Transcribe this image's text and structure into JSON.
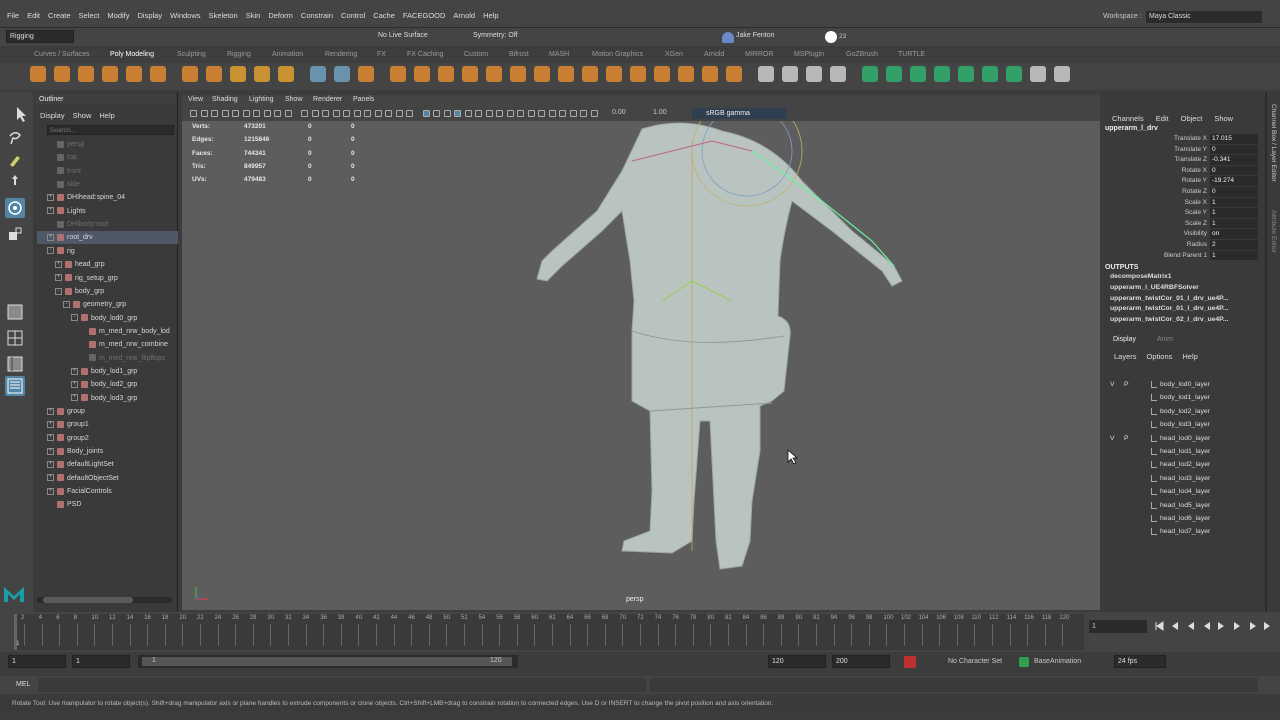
{
  "menubar": {
    "items": [
      "File",
      "Edit",
      "Create",
      "Select",
      "Modify",
      "Display",
      "Windows",
      "Skeleton",
      "Skin",
      "Deform",
      "Constrain",
      "Control",
      "Cache",
      "FACEGOOD",
      "Arnold",
      "Help"
    ],
    "workspace_label": "Workspace :",
    "workspace_value": "Maya Classic"
  },
  "status": {
    "mode": "Rigging",
    "live_surface": "No Live Surface",
    "symmetry": "Symmetry: Off",
    "user": "Jake Fenton",
    "notifications": "23"
  },
  "shelf_tabs": [
    "Curves / Surfaces",
    "Poly Modeling",
    "Sculpting",
    "Rigging",
    "Animation",
    "Rendering",
    "FX",
    "FX Caching",
    "Custom",
    "Bifrost",
    "MASH",
    "Motion Graphics",
    "XGen",
    "Arnold",
    "MIRROR",
    "MSPlugin",
    "GoZBrush",
    "TURTLE"
  ],
  "shelf_active": "Poly Modeling",
  "outliner": {
    "title": "Outliner",
    "menus": [
      "Display",
      "Show",
      "Help"
    ],
    "search_placeholder": "Search...",
    "rows": [
      {
        "label": "persp",
        "indent": 0,
        "dim": true,
        "exp": ""
      },
      {
        "label": "top",
        "indent": 0,
        "dim": true,
        "exp": ""
      },
      {
        "label": "front",
        "indent": 0,
        "dim": true,
        "exp": ""
      },
      {
        "label": "side",
        "indent": 0,
        "dim": true,
        "exp": ""
      },
      {
        "label": "DHIhead:spine_04",
        "indent": 0,
        "dim": false,
        "exp": "+"
      },
      {
        "label": "Lights",
        "indent": 0,
        "dim": false,
        "exp": "+"
      },
      {
        "label": "DHIbody:root",
        "indent": 0,
        "dim": true,
        "exp": ""
      },
      {
        "label": "root_drv",
        "indent": 0,
        "dim": false,
        "exp": "+",
        "sel": true
      },
      {
        "label": "rig",
        "indent": 0,
        "dim": false,
        "exp": "-"
      },
      {
        "label": "head_grp",
        "indent": 1,
        "dim": false,
        "exp": "+"
      },
      {
        "label": "rig_setup_grp",
        "indent": 1,
        "dim": false,
        "exp": "+"
      },
      {
        "label": "body_grp",
        "indent": 1,
        "dim": false,
        "exp": "-"
      },
      {
        "label": "geometry_grp",
        "indent": 2,
        "dim": false,
        "exp": "-"
      },
      {
        "label": "body_lod0_grp",
        "indent": 3,
        "dim": false,
        "exp": "-"
      },
      {
        "label": "m_med_nrw_body_lod",
        "indent": 4,
        "dim": false,
        "exp": ""
      },
      {
        "label": "m_med_nrw_combine",
        "indent": 4,
        "dim": false,
        "exp": ""
      },
      {
        "label": "m_med_nrw_flipflops",
        "indent": 4,
        "dim": true,
        "exp": ""
      },
      {
        "label": "body_lod1_grp",
        "indent": 3,
        "dim": false,
        "exp": "+"
      },
      {
        "label": "body_lod2_grp",
        "indent": 3,
        "dim": false,
        "exp": "+"
      },
      {
        "label": "body_lod3_grp",
        "indent": 3,
        "dim": false,
        "exp": "+"
      },
      {
        "label": "group",
        "indent": 0,
        "dim": false,
        "exp": "+"
      },
      {
        "label": "group1",
        "indent": 0,
        "dim": false,
        "exp": "+"
      },
      {
        "label": "group2",
        "indent": 0,
        "dim": false,
        "exp": "+"
      },
      {
        "label": "Body_joints",
        "indent": 0,
        "dim": false,
        "exp": "+"
      },
      {
        "label": "defaultLightSet",
        "indent": 0,
        "dim": false,
        "exp": "+"
      },
      {
        "label": "defaultObjectSet",
        "indent": 0,
        "dim": false,
        "exp": "+"
      },
      {
        "label": "FacialControls",
        "indent": 0,
        "dim": false,
        "exp": "+"
      },
      {
        "label": "PSD",
        "indent": 0,
        "dim": false,
        "exp": ""
      }
    ]
  },
  "viewport": {
    "menus": [
      "View",
      "Shading",
      "Lighting",
      "Show",
      "Renderer",
      "Panels"
    ],
    "exposure": "0.00",
    "gamma": "1.00",
    "colorspace": "sRGB gamma",
    "camera": "persp",
    "hud": [
      [
        "Verts:",
        "473201",
        "0",
        "0"
      ],
      [
        "Edges:",
        "1215846",
        "0",
        "0"
      ],
      [
        "Faces:",
        "744341",
        "0",
        "0"
      ],
      [
        "Tris:",
        "849957",
        "0",
        "0"
      ],
      [
        "UVs:",
        "479483",
        "0",
        "0"
      ]
    ]
  },
  "channel": {
    "menus": [
      "Channels",
      "Edit",
      "Object",
      "Show"
    ],
    "object": "upperarm_l_drv",
    "attrs": [
      [
        "Translate X",
        "17.015"
      ],
      [
        "Translate Y",
        "0"
      ],
      [
        "Translate Z",
        "-0.341"
      ],
      [
        "Rotate X",
        "0"
      ],
      [
        "Rotate Y",
        "-19.274"
      ],
      [
        "Rotate Z",
        "0"
      ],
      [
        "Scale X",
        "1"
      ],
      [
        "Scale Y",
        "1"
      ],
      [
        "Scale Z",
        "1"
      ],
      [
        "Visibility",
        "on"
      ],
      [
        "Radius",
        "2"
      ],
      [
        "Blend Parent 1",
        "1"
      ]
    ],
    "outputs_label": "OUTPUTS",
    "outputs": [
      "decomposeMatrix1",
      "upperarm_l_UE4RBFSolver",
      "upperarm_twistCor_01_l_drv_ue4P...",
      "upperarm_twistCor_01_l_drv_ue4P...",
      "upperarm_twistCor_02_l_drv_ue4P..."
    ],
    "side_tabs": "Channel Box / Layer Editor",
    "side_tab2": "Attribute Editor"
  },
  "layers": {
    "tabs": [
      "Display",
      "Anim"
    ],
    "menus": [
      "Layers",
      "Options",
      "Help"
    ],
    "rows": [
      [
        "V",
        "P",
        "body_lod0_layer"
      ],
      [
        "",
        "",
        "body_lod1_layer"
      ],
      [
        "",
        "",
        "body_lod2_layer"
      ],
      [
        "",
        "",
        "body_lod3_layer"
      ],
      [
        "V",
        "P",
        "head_lod0_layer"
      ],
      [
        "",
        "",
        "head_lod1_layer"
      ],
      [
        "",
        "",
        "head_lod2_layer"
      ],
      [
        "",
        "",
        "head_lod3_layer"
      ],
      [
        "",
        "",
        "head_lod4_layer"
      ],
      [
        "",
        "",
        "head_lod5_layer"
      ],
      [
        "",
        "",
        "head_lod6_layer"
      ],
      [
        "",
        "",
        "head_lod7_layer"
      ]
    ]
  },
  "timeline": {
    "ticks": [
      "2",
      "4",
      "6",
      "8",
      "10",
      "12",
      "14",
      "16",
      "18",
      "20",
      "22",
      "24",
      "26",
      "28",
      "30",
      "32",
      "34",
      "36",
      "38",
      "40",
      "42",
      "44",
      "46",
      "48",
      "50",
      "52",
      "54",
      "56",
      "58",
      "60",
      "62",
      "64",
      "66",
      "68",
      "70",
      "72",
      "74",
      "76",
      "78",
      "80",
      "82",
      "84",
      "86",
      "88",
      "90",
      "92",
      "94",
      "96",
      "98",
      "100",
      "102",
      "104",
      "106",
      "108",
      "110",
      "112",
      "114",
      "116",
      "118",
      "120"
    ],
    "current": "1",
    "start_marker": "1"
  },
  "range": {
    "start": "1",
    "anim_start": "1",
    "slider_start": "1",
    "slider_end": "120",
    "end": "120",
    "anim_end": "200",
    "char_set": "No Character Set",
    "anim_layer": "BaseAnimation",
    "fps": "24 fps"
  },
  "mel": {
    "label": "MEL"
  },
  "help": "Rotate Tool: Use manipulator to rotate object(s). Shift+drag manipulator axis or plane handles to extrude components or clone objects. Ctrl+Shift+LMB+drag to constrain rotation to connected edges. Use D or INSERT to change the pivot position and axis orientation.",
  "colors": {
    "accent": "#5285a6",
    "body": "#b9c4c1",
    "panel": "#3a3a3a",
    "maya_logo": "#18a0a8"
  }
}
